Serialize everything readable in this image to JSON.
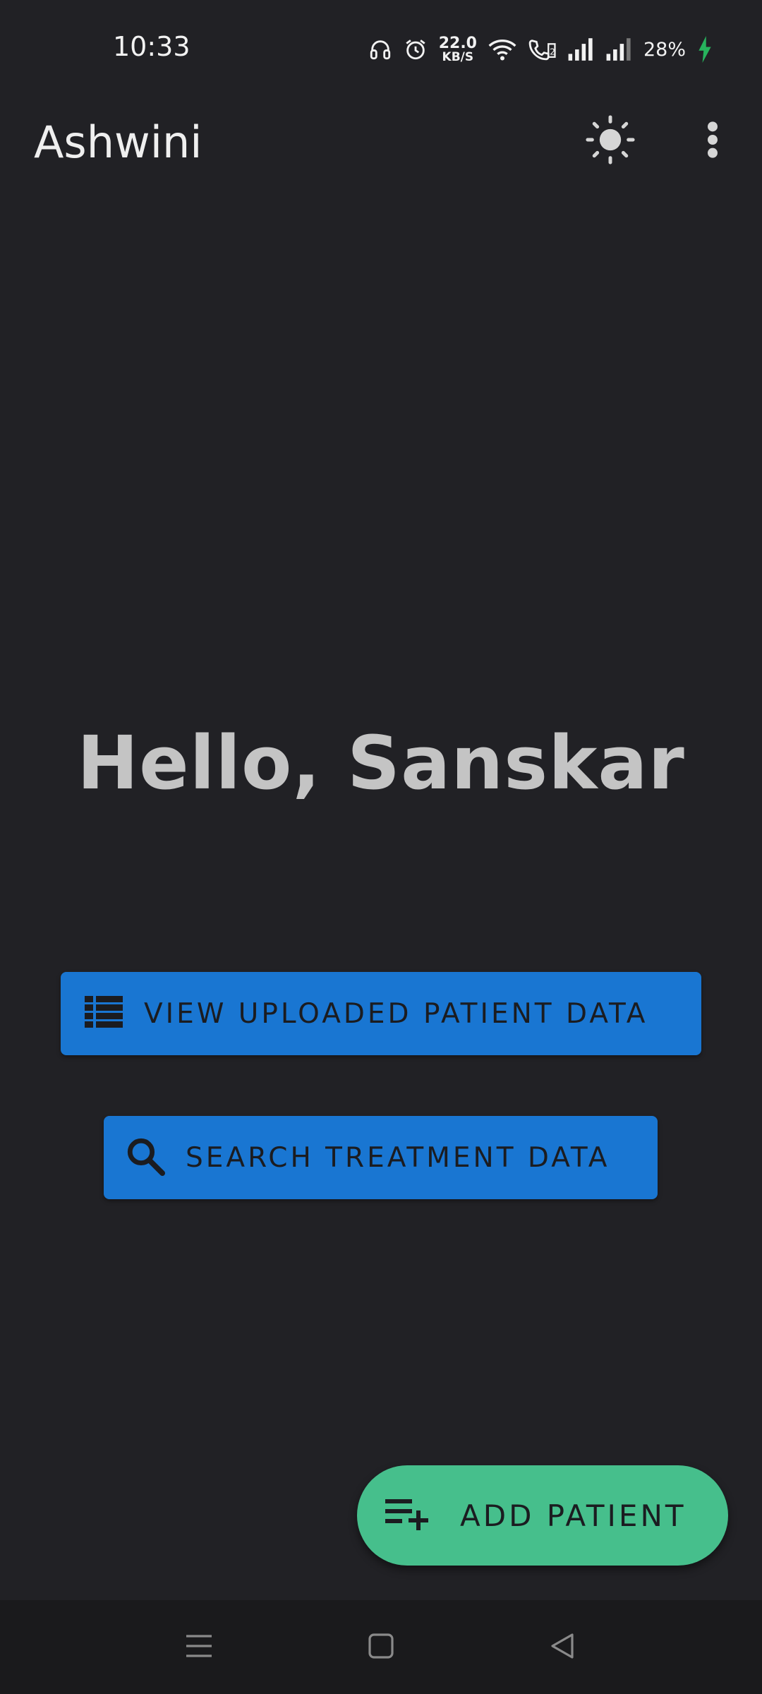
{
  "status_bar": {
    "time": "10:33",
    "net_speed_value": "22.0",
    "net_speed_unit": "KB/S",
    "battery": "28%",
    "icons": [
      "headset-icon",
      "alarm-icon",
      "wifi-icon",
      "volte-call-icon",
      "signal-icon",
      "signal-icon",
      "charging-icon"
    ]
  },
  "app_bar": {
    "title": "Ashwini",
    "theme_icon": "brightness-icon",
    "menu_icon": "more-vert-icon"
  },
  "main": {
    "greeting": "Hello, Sanskar",
    "view_button_label": "VIEW UPLOADED PATIENT DATA",
    "view_button_icon": "list-icon",
    "search_button_label": "SEARCH TREATMENT DATA",
    "search_button_icon": "search-icon"
  },
  "fab": {
    "label": "ADD PATIENT",
    "icon": "playlist-add-icon"
  },
  "nav_bar": {
    "icons": [
      "menu-icon",
      "home-icon",
      "back-icon"
    ]
  },
  "colors": {
    "background": "#212125",
    "primary_button": "#1976d2",
    "fab": "#46bf8c",
    "greeting_text": "#c4c4c4",
    "charging": "#27b35d"
  }
}
